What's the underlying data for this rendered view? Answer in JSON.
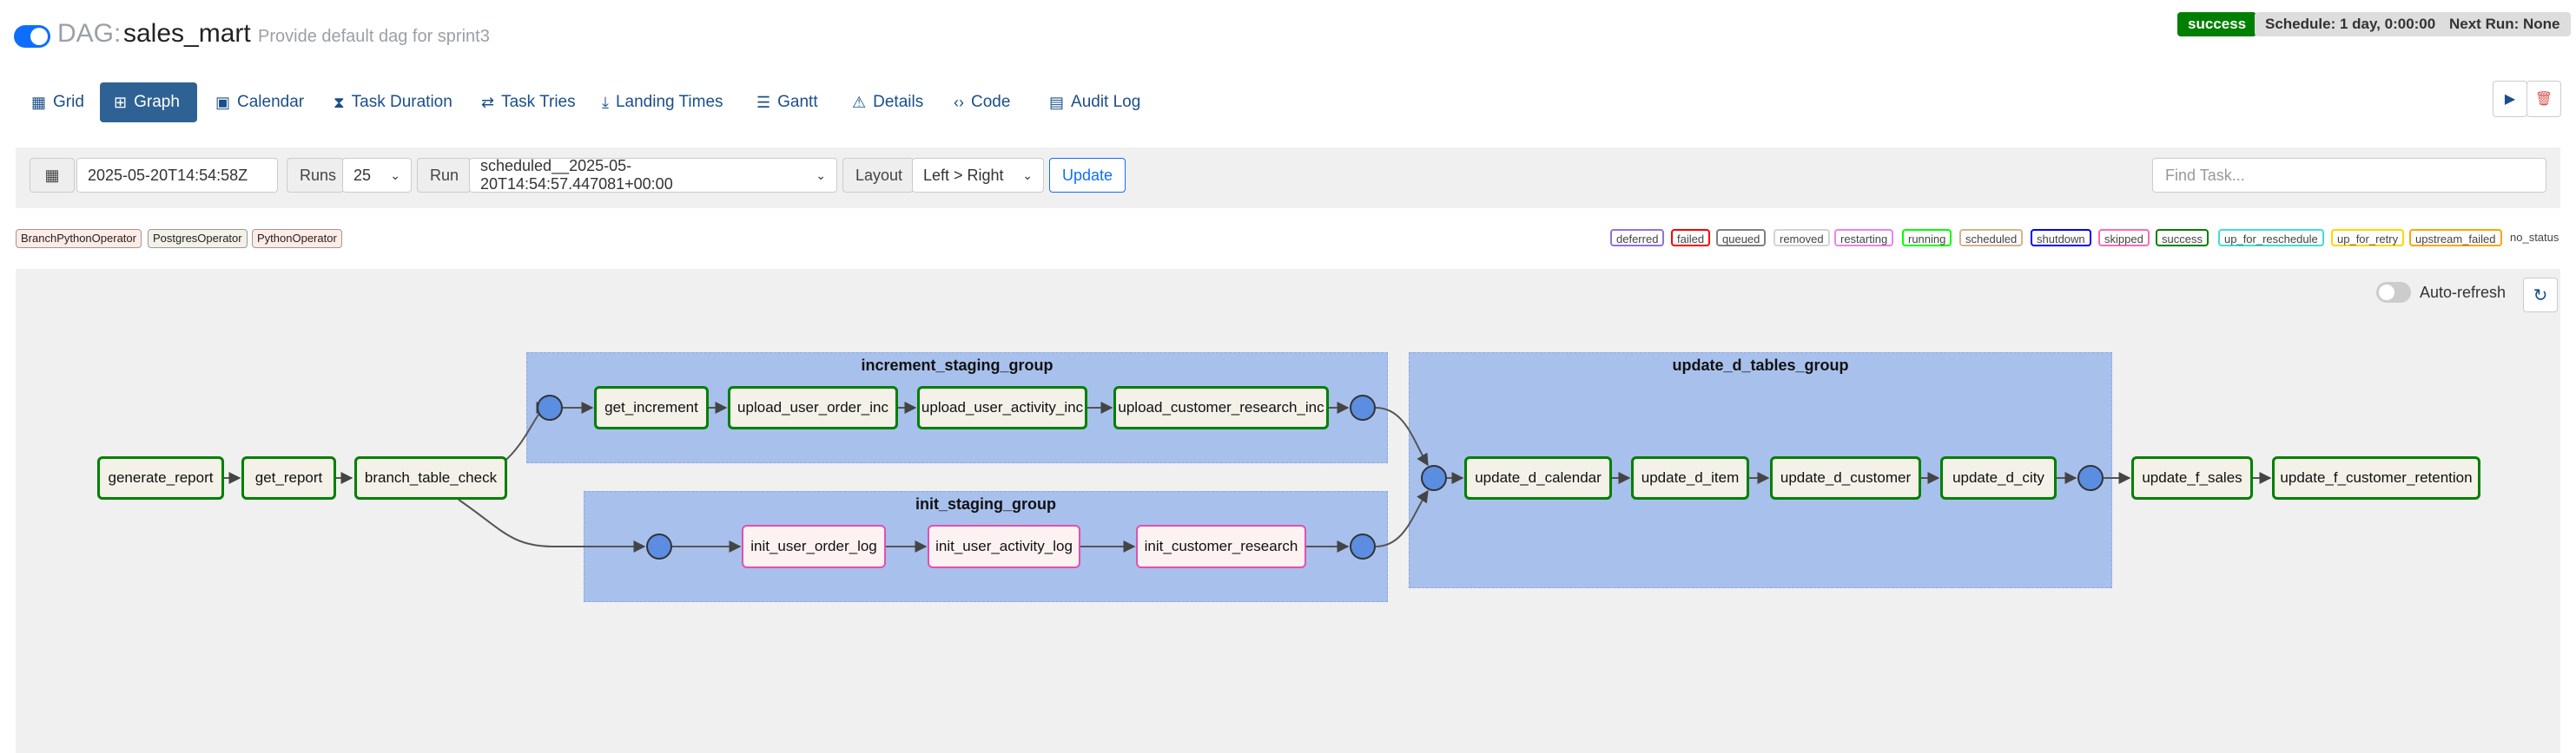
{
  "header": {
    "dag_prefix": "DAG:",
    "dag_name": "sales_mart",
    "description": "Provide default dag for sprint3",
    "state": "success",
    "schedule": "Schedule: 1 day, 0:00:00",
    "next_run": "Next Run: None"
  },
  "nav": {
    "grid": "Grid",
    "graph": "Graph",
    "calendar": "Calendar",
    "task_duration": "Task Duration",
    "task_tries": "Task Tries",
    "landing_times": "Landing Times",
    "gantt": "Gantt",
    "details": "Details",
    "code": "Code",
    "audit_log": "Audit Log"
  },
  "toolbar": {
    "base_date": "2025-05-20T14:54:58Z",
    "runs_label": "Runs",
    "runs_value": "25",
    "run_label": "Run",
    "run_value": "scheduled__2025-05-20T14:54:57.447081+00:00",
    "layout_label": "Layout",
    "layout_value": "Left > Right",
    "update_label": "Update",
    "find_placeholder": "Find Task..."
  },
  "operators": [
    "BranchPythonOperator",
    "PostgresOperator",
    "PythonOperator"
  ],
  "states": [
    {
      "label": "deferred",
      "color": "#9370db"
    },
    {
      "label": "failed",
      "color": "#ff0000"
    },
    {
      "label": "queued",
      "color": "#808080"
    },
    {
      "label": "removed",
      "color": "#d3d3d3"
    },
    {
      "label": "restarting",
      "color": "#ee82ee"
    },
    {
      "label": "running",
      "color": "#00ff00"
    },
    {
      "label": "scheduled",
      "color": "#d2b48c"
    },
    {
      "label": "shutdown",
      "color": "#0000ff"
    },
    {
      "label": "skipped",
      "color": "#ff69b4"
    },
    {
      "label": "success",
      "color": "#008000"
    },
    {
      "label": "up_for_reschedule",
      "color": "#40e0d0"
    },
    {
      "label": "up_for_retry",
      "color": "#ffd700"
    },
    {
      "label": "upstream_failed",
      "color": "#ffa500"
    },
    {
      "label": "no_status",
      "color": ""
    }
  ],
  "graph": {
    "auto_refresh": "Auto-refresh",
    "groups": {
      "increment": "increment_staging_group",
      "init": "init_staging_group",
      "update_d": "update_d_tables_group"
    },
    "tasks": {
      "generate_report": "generate_report",
      "get_report": "get_report",
      "branch_table_check": "branch_table_check",
      "get_increment": "get_increment",
      "upload_user_order_inc": "upload_user_order_inc",
      "upload_user_activity_inc": "upload_user_activity_inc",
      "upload_customer_research_inc": "upload_customer_research_inc",
      "init_user_order_log": "init_user_order_log",
      "init_user_activity_log": "init_user_activity_log",
      "init_customer_research": "init_customer_research",
      "update_d_calendar": "update_d_calendar",
      "update_d_item": "update_d_item",
      "update_d_customer": "update_d_customer",
      "update_d_city": "update_d_city",
      "update_f_sales": "update_f_sales",
      "update_f_customer_retention": "update_f_customer_retention"
    },
    "colors": {
      "success": "#008000",
      "skipped": "#e34fb1",
      "group_fill": "#a8c0ec",
      "join_fill": "#5b8de0"
    }
  }
}
